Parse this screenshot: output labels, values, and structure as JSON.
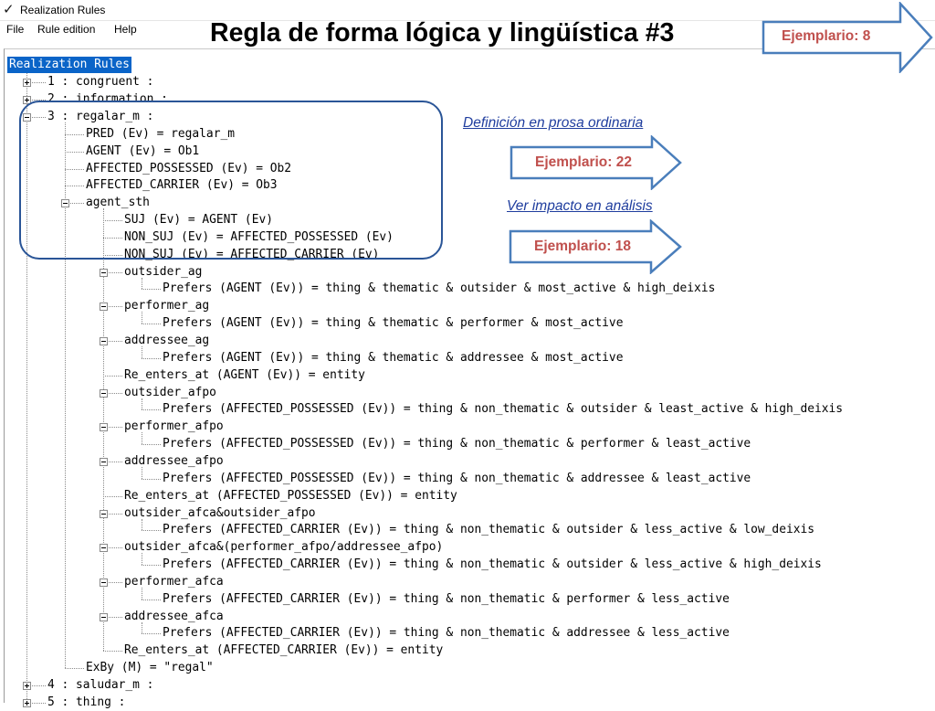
{
  "window": {
    "icon": "✓",
    "title": "Realization Rules"
  },
  "menu": [
    "File",
    "Rule edition",
    "Help"
  ],
  "slide_title": "Regla de forma lógica y lingüística #3",
  "annotations": {
    "ejemplario_top": "Ejemplario: 8",
    "definicion_link": "Definición en prosa ordinaria",
    "ejemplario_22": "Ejemplario: 22",
    "ver_impacto_link": "Ver impacto en análisis",
    "ejemplario_18": "Ejemplario: 18"
  },
  "tree": {
    "root": "Realization Rules",
    "rows": [
      "1 : congruent :",
      "2 : information :",
      "3 : regalar_m :",
      "PRED (Ev) = regalar_m",
      "AGENT (Ev) = Ob1",
      "AFFECTED_POSSESSED (Ev) = Ob2",
      "AFFECTED_CARRIER (Ev) = Ob3",
      "agent_sth",
      "SUJ (Ev) = AGENT (Ev)",
      "NON_SUJ (Ev) = AFFECTED_POSSESSED (Ev)",
      "NON_SUJ (Ev) = AFFECTED_CARRIER (Ev)",
      "outsider_ag",
      "Prefers (AGENT (Ev)) = thing & thematic & outsider & most_active & high_deixis",
      "performer_ag",
      "Prefers (AGENT (Ev)) = thing & thematic & performer & most_active",
      "addressee_ag",
      "Prefers (AGENT (Ev)) = thing & thematic & addressee & most_active",
      "Re_enters_at (AGENT (Ev)) = entity",
      "outsider_afpo",
      "Prefers (AFFECTED_POSSESSED (Ev)) = thing & non_thematic & outsider & least_active & high_deixis",
      "performer_afpo",
      "Prefers (AFFECTED_POSSESSED (Ev)) = thing & non_thematic & performer & least_active",
      "addressee_afpo",
      "Prefers (AFFECTED_POSSESSED (Ev)) = thing & non_thematic & addressee & least_active",
      "Re_enters_at (AFFECTED_POSSESSED (Ev)) = entity",
      "outsider_afca&outsider_afpo",
      "Prefers (AFFECTED_CARRIER (Ev)) = thing & non_thematic & outsider & less_active & low_deixis",
      "outsider_afca&(performer_afpo/addressee_afpo)",
      "Prefers (AFFECTED_CARRIER (Ev)) = thing & non_thematic & outsider & less_active & high_deixis",
      "performer_afca",
      "Prefers (AFFECTED_CARRIER (Ev)) = thing & non_thematic & performer & less_active",
      "addressee_afca",
      "Prefers (AFFECTED_CARRIER (Ev)) = thing & non_thematic & addressee & less_active",
      "Re_enters_at (AFFECTED_CARRIER (Ev)) = entity",
      "ExBy (M) = \"regal\"",
      "4 : saludar_m :",
      "5 : thing :"
    ]
  },
  "colors": {
    "selection": "#0a64c8",
    "arrow_border": "#4a7ebb",
    "arrow_text": "#c0504d",
    "link": "#1f3d9e",
    "highlight_box": "#2a5597"
  },
  "icons": [
    "check-icon",
    "plus-box-icon",
    "minus-box-icon",
    "right-arrow-shape"
  ]
}
